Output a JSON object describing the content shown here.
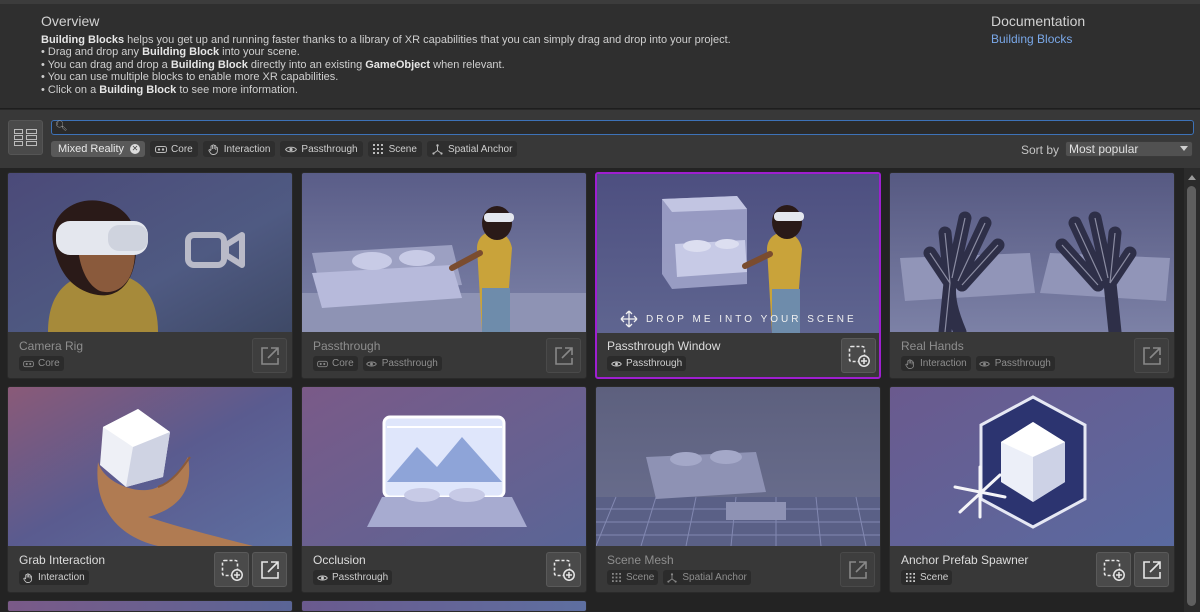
{
  "overview": {
    "title": "Overview",
    "intro_bold": "Building Blocks",
    "intro_rest": " helps you get up and running faster thanks to a library of XR capabilities that you can simply drag and drop into your project.",
    "bullet1_a": "• Drag and drop any ",
    "bullet1_b": "Building Block",
    "bullet1_c": " into your scene.",
    "bullet2_a": "• You can drag and drop a ",
    "bullet2_b": "Building Block",
    "bullet2_c": " directly into an existing ",
    "bullet2_d": "GameObject",
    "bullet2_e": " when relevant.",
    "bullet3": "• You can use multiple blocks to enable more XR capabilities.",
    "bullet4_a": "• Click on a ",
    "bullet4_b": "Building Block",
    "bullet4_c": " to see more information."
  },
  "documentation": {
    "title": "Documentation",
    "link": "Building Blocks"
  },
  "search": {
    "value": "",
    "placeholder": ""
  },
  "filters": {
    "active": "Mixed Reality",
    "chips": [
      "Core",
      "Interaction",
      "Passthrough",
      "Scene",
      "Spatial Anchor"
    ]
  },
  "sort": {
    "label": "Sort by",
    "value": "Most popular"
  },
  "drop_hint": "DROP ME INTO YOUR SCENE",
  "cards": [
    {
      "title": "Camera Rig",
      "tags": [
        "Core"
      ]
    },
    {
      "title": "Passthrough",
      "tags": [
        "Core",
        "Passthrough"
      ]
    },
    {
      "title": "Passthrough Window",
      "tags": [
        "Passthrough"
      ]
    },
    {
      "title": "Real Hands",
      "tags": [
        "Interaction",
        "Passthrough"
      ]
    },
    {
      "title": "Grab Interaction",
      "tags": [
        "Interaction"
      ]
    },
    {
      "title": "Occlusion",
      "tags": [
        "Passthrough"
      ]
    },
    {
      "title": "Scene Mesh",
      "tags": [
        "Scene",
        "Spatial Anchor"
      ]
    },
    {
      "title": "Anchor Prefab Spawner",
      "tags": [
        "Scene"
      ]
    }
  ],
  "colors": {
    "accent_link": "#7aa8e8",
    "selection": "#9e1fd0",
    "search_border": "#3d72b8"
  }
}
